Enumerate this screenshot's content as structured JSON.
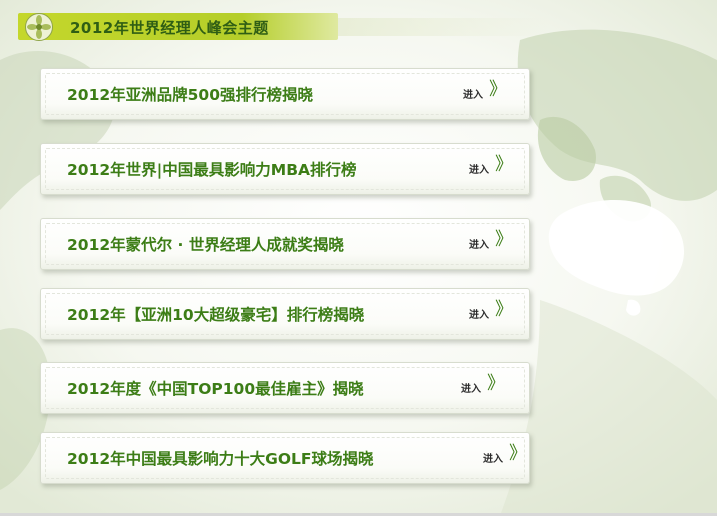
{
  "header": {
    "title": "2012年世界经理人峰会主题",
    "emblem_icon": "floral-emblem-icon"
  },
  "colors": {
    "accent": "#3c7d16",
    "header_bar": "#c4d72b",
    "header_text": "#2f5e14"
  },
  "items": [
    {
      "title": "2012年亚洲品牌500强排行榜揭晓",
      "enter_label": "进入",
      "arrow": "》"
    },
    {
      "title": "2012年世界|中国最具影响力MBA排行榜",
      "enter_label": "进入",
      "arrow": "》"
    },
    {
      "title": "2012年蒙代尔 · 世界经理人成就奖揭晓",
      "enter_label": "进入",
      "arrow": "》"
    },
    {
      "title": "2012年【亚洲10大超级豪宅】排行榜揭晓",
      "enter_label": "进入",
      "arrow": "》"
    },
    {
      "title": "2012年度《中国TOP100最佳雇主》揭晓",
      "enter_label": "进入",
      "arrow": "》"
    },
    {
      "title": "2012年中国最具影响力十大GOLF球场揭晓",
      "enter_label": "进入",
      "arrow": "》"
    }
  ]
}
